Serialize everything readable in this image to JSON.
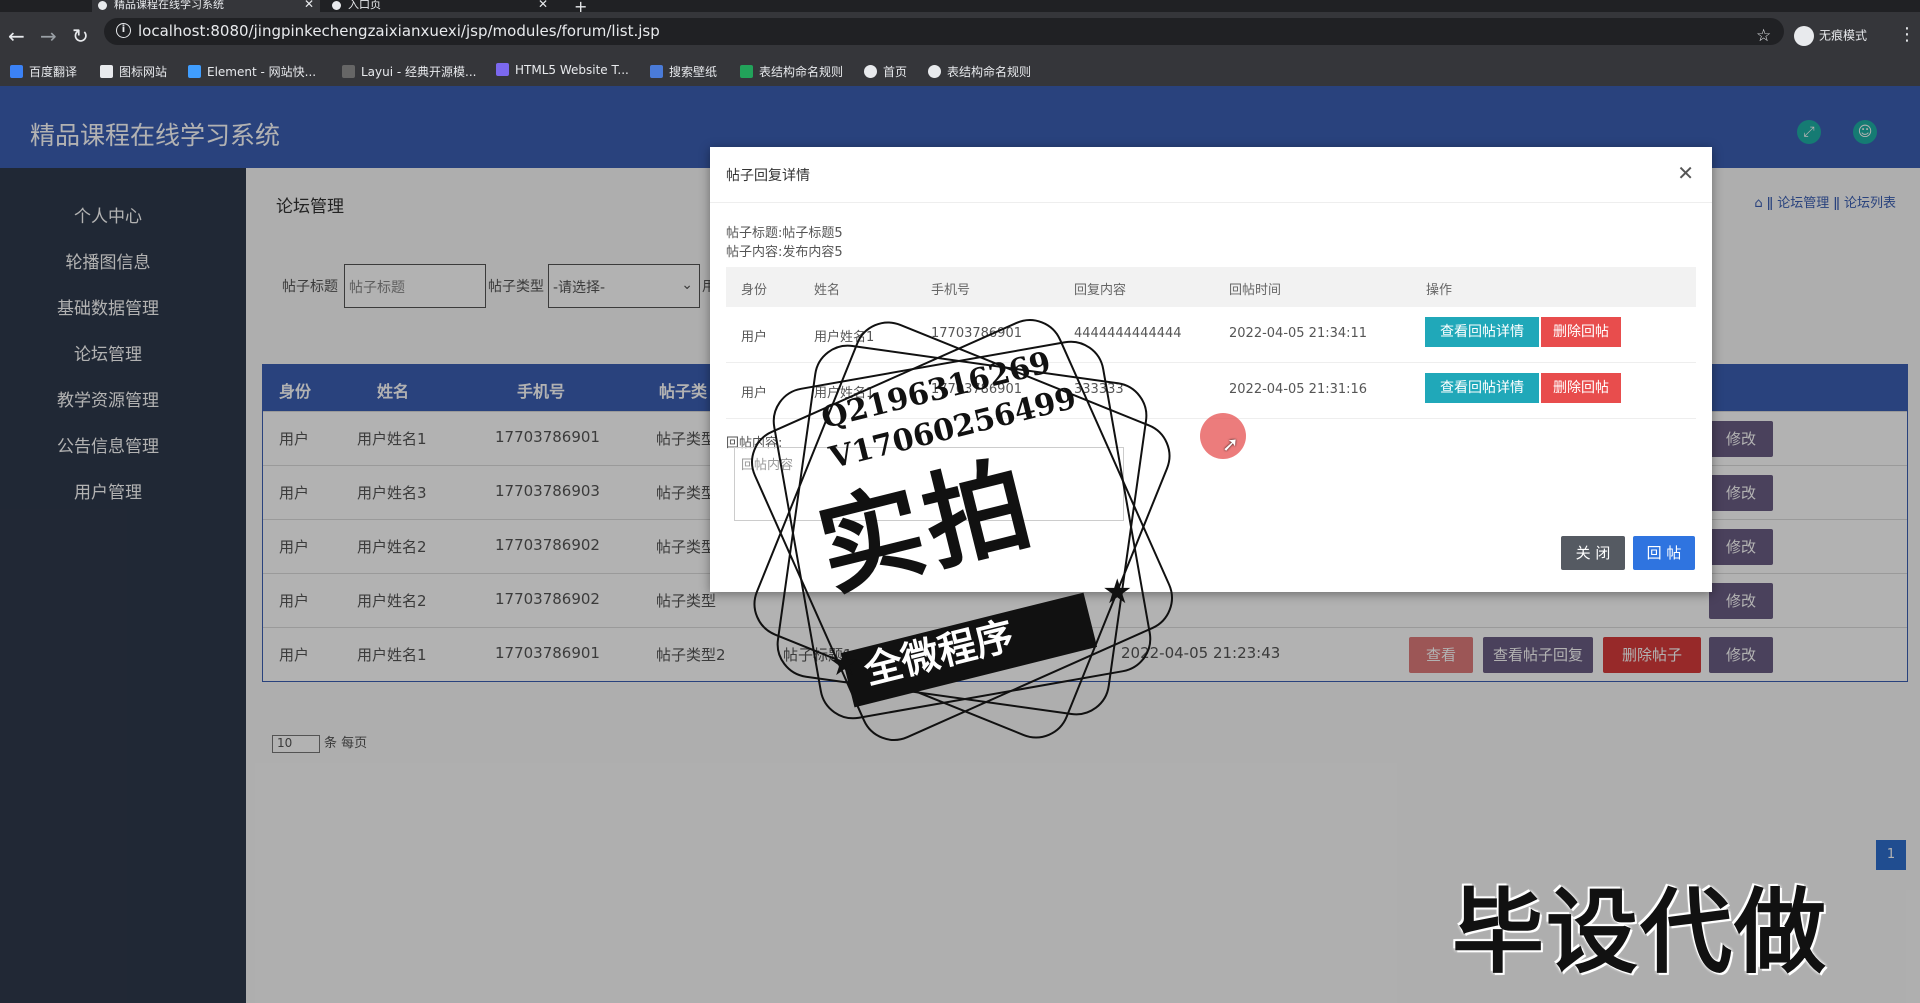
{
  "browser": {
    "tabs": [
      {
        "title": "精品课程在线学习系统",
        "active": true
      },
      {
        "title": "入口页",
        "active": false
      }
    ],
    "url": "localhost:8080/jingpinkechengzaixianxuexi/jsp/modules/forum/list.jsp",
    "profile": "无痕模式",
    "bookmarks": [
      "百度翻译",
      "图标网站",
      "Element - 网站快...",
      "Layui - 经典开源模...",
      "HTML5 Website T...",
      "搜索壁纸",
      "表结构命名规则",
      "首页",
      "表结构命名规则"
    ]
  },
  "app": {
    "title": "精品课程在线学习系统",
    "sidebar": [
      "个人中心",
      "轮播图信息",
      "基础数据管理",
      "论坛管理",
      "教学资源管理",
      "公告信息管理",
      "用户管理"
    ],
    "page_title": "论坛管理",
    "breadcrumb": [
      "论坛管理",
      "论坛列表"
    ],
    "filters": {
      "title_label": "帖子标题",
      "title_placeholder": "帖子标题",
      "type_label": "帖子类型",
      "type_value": "-请选择-",
      "extra_label": "用"
    },
    "table": {
      "columns": [
        "身份",
        "姓名",
        "手机号",
        "帖子类"
      ],
      "rows": [
        {
          "role": "用户",
          "name": "用户姓名1",
          "phone": "17703786901",
          "type": "帖子类型",
          "title": "",
          "time": ""
        },
        {
          "role": "用户",
          "name": "用户姓名3",
          "phone": "17703786903",
          "type": "帖子类型",
          "title": "",
          "time": ""
        },
        {
          "role": "用户",
          "name": "用户姓名2",
          "phone": "17703786902",
          "type": "帖子类型",
          "title": "",
          "time": ""
        },
        {
          "role": "用户",
          "name": "用户姓名2",
          "phone": "17703786902",
          "type": "帖子类型",
          "title": "",
          "time": ""
        },
        {
          "role": "用户",
          "name": "用户姓名1",
          "phone": "17703786901",
          "type": "帖子类型2",
          "title": "帖子标题1",
          "time": "2022-04-05 21:23:43"
        }
      ],
      "btn_view": "查看",
      "btn_replies": "查看帖子回复",
      "btn_delete": "删除帖子",
      "btn_edit": "修改"
    },
    "pager": {
      "per_page": "10",
      "suffix": "条 每页",
      "current_page": "1"
    }
  },
  "modal": {
    "title": "帖子回复详情",
    "post_title": "帖子标题:帖子标题5",
    "post_content": "帖子内容:发布内容5",
    "columns": [
      "身份",
      "姓名",
      "手机号",
      "回复内容",
      "回帖时间",
      "操作"
    ],
    "rows": [
      {
        "role": "用户",
        "name": "用户姓名1",
        "phone": "17703786901",
        "content": "4444444444444",
        "time": "2022-04-05 21:34:11"
      },
      {
        "role": "用户",
        "name": "用户姓名1",
        "phone": "17703786901",
        "content": "333333",
        "time": "2022-04-05 21:31:16"
      }
    ],
    "btn_view_reply": "查看回帖详情",
    "btn_delete_reply": "删除回帖",
    "reply_label": "回帖内容:",
    "reply_placeholder": "回帖内容",
    "btn_close": "关 闭",
    "btn_reply": "回 帖"
  },
  "overlay": {
    "stamp_qq": "Q2196316269",
    "stamp_wx": "V17060256499",
    "stamp_main": "实拍",
    "stamp_band": "全微程序",
    "watermark": "毕设代做"
  },
  "colors": {
    "header": "#3b5fb4",
    "sidebar": "#2f3a4c",
    "teal": "#20a8b9",
    "danger": "#e84d4d"
  }
}
